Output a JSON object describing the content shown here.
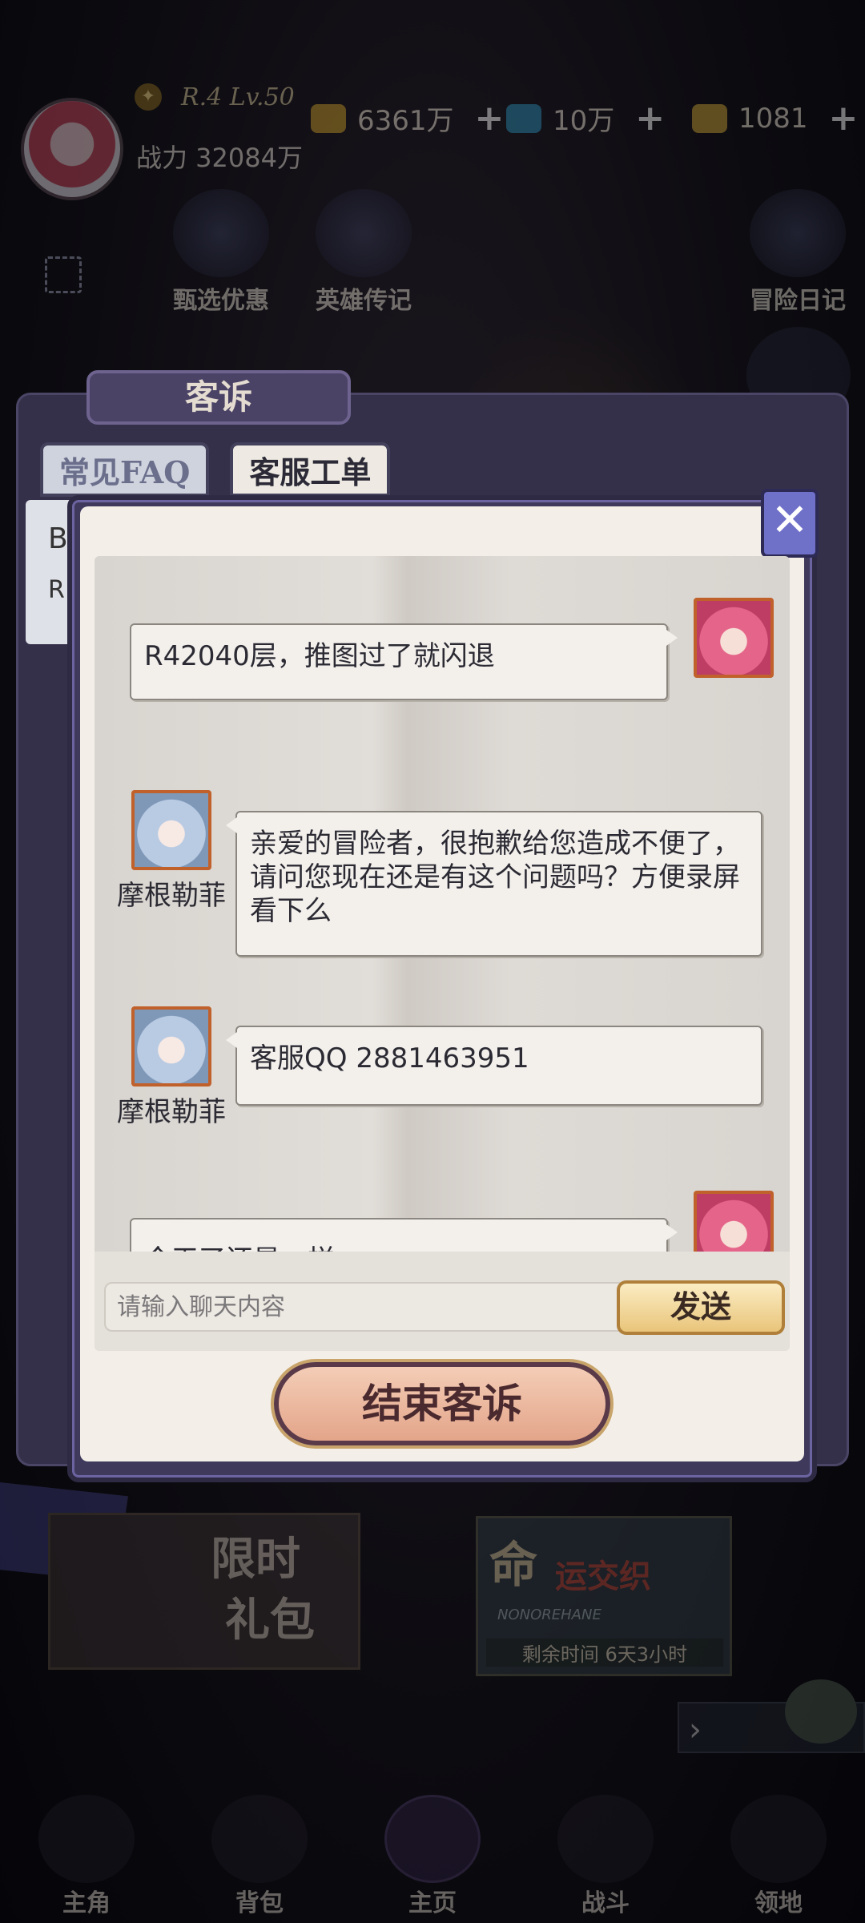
{
  "hud": {
    "rank": "R.4 Lv.50",
    "power": "战力 32084万",
    "resources": [
      {
        "icon": "gold-coin-icon",
        "value": "6361万"
      },
      {
        "icon": "blue-gem-icon",
        "value": "10万"
      },
      {
        "icon": "gold-gem-icon",
        "value": "1081"
      }
    ],
    "buttons": [
      "甄选优惠",
      "英雄传记",
      "冒险日记"
    ]
  },
  "panel": {
    "title": "客诉",
    "tabs": [
      "常见FAQ",
      "客服工单"
    ],
    "behind_card_letter": "B",
    "behind_card_letter2": "R"
  },
  "chat": {
    "messages": [
      {
        "from": "player",
        "text": "R42040层，推图过了就闪退"
      },
      {
        "from": "staff",
        "name": "摩根勒菲",
        "text": "亲爱的冒险者，很抱歉给您造成不便了，请问您现在还是有这个问题吗？方便录屏看下么"
      },
      {
        "from": "staff",
        "name": "摩根勒菲",
        "text": "客服QQ 2881463951"
      },
      {
        "from": "player",
        "text": "今天了还是一样"
      }
    ],
    "input_placeholder": "请输入聊天内容",
    "send_label": "发送",
    "end_label": "结束客诉"
  },
  "bottom": {
    "banner_left": [
      "限时",
      "礼包"
    ],
    "banner_right_title": "命",
    "banner_right_title2": "运交织",
    "banner_right_sub": "NONOREHANE",
    "banner_right_time": "剩余时间 6天3小时",
    "nav": [
      "主角",
      "背包",
      "主页",
      "战斗",
      "领地"
    ]
  },
  "colors": {
    "accent_purple": "#6f70c8",
    "bubble_bg": "#f3f0ec",
    "send_gold": "#e9c57a",
    "end_button": "#e3a58a"
  }
}
